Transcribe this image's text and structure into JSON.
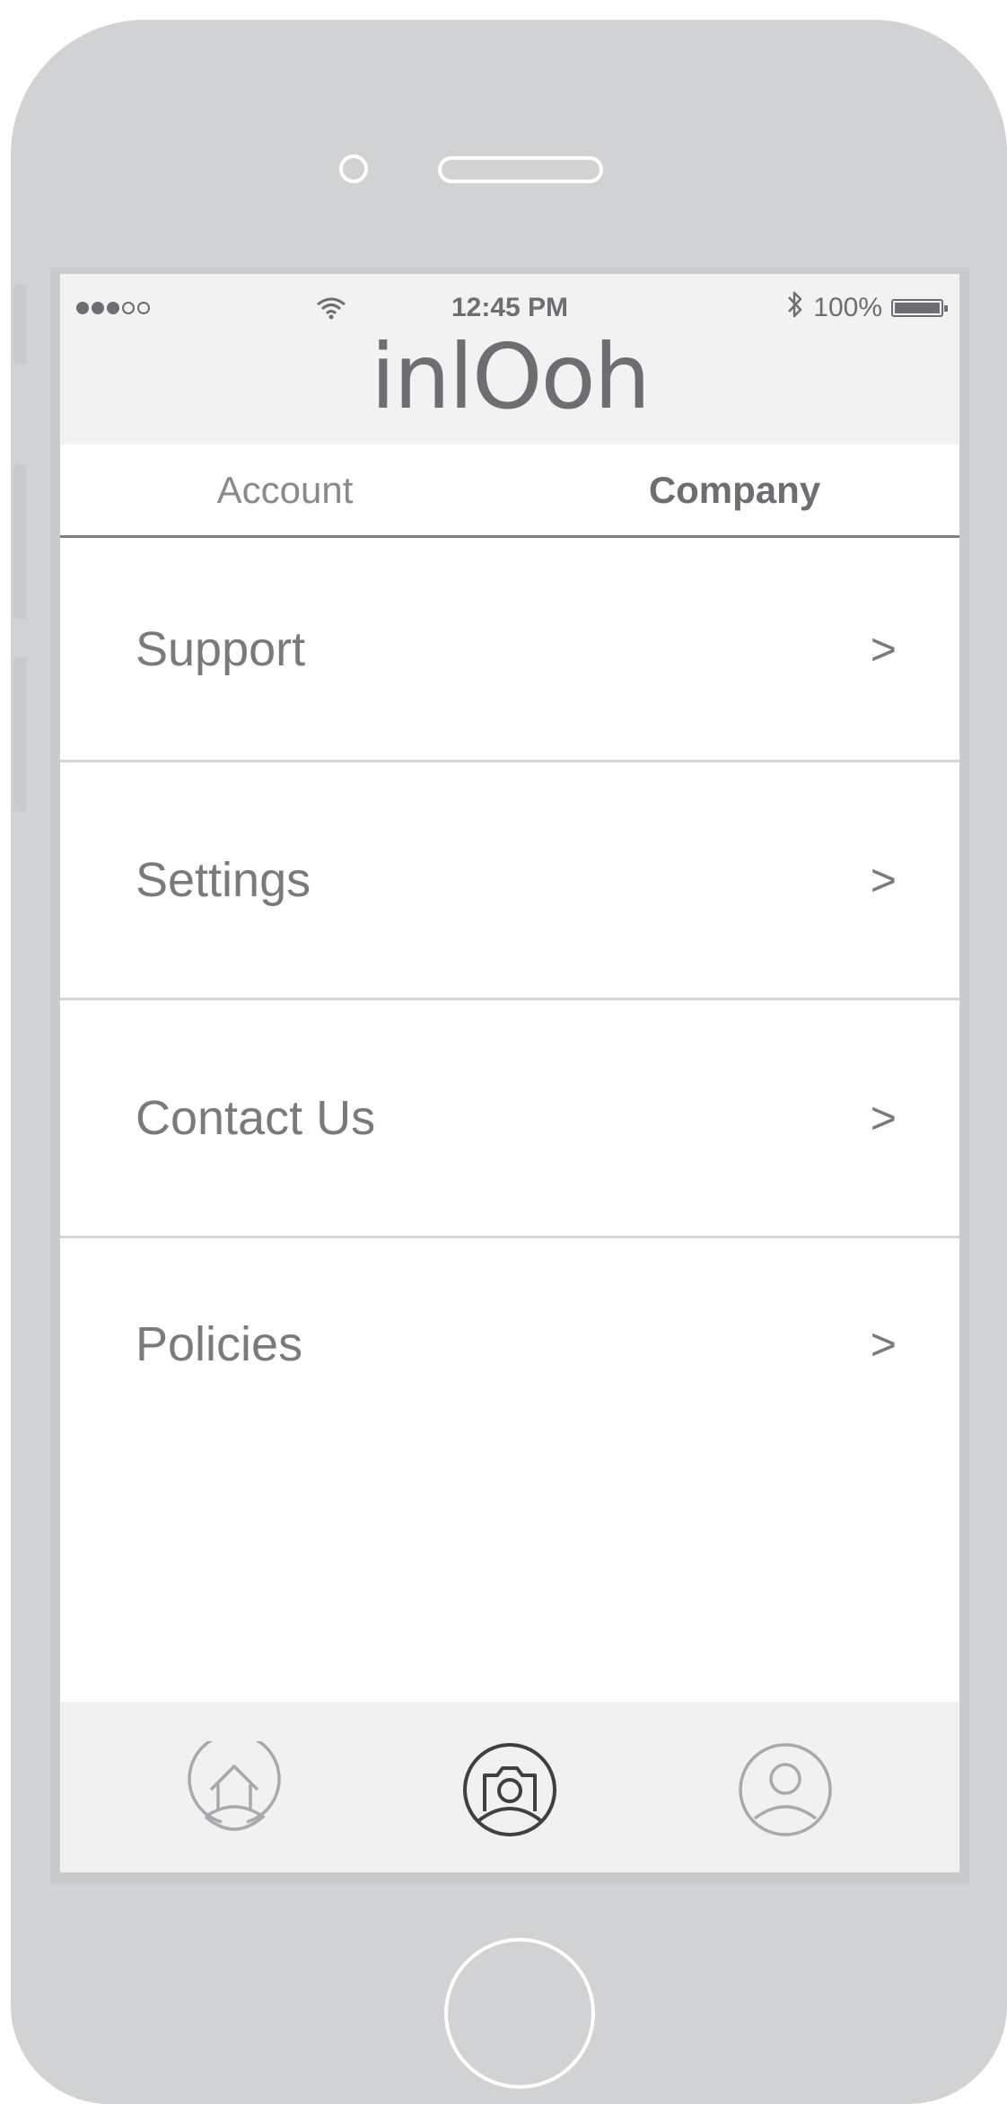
{
  "status_bar": {
    "time": "12:45 PM",
    "battery": "100%",
    "battery_level": 1.0,
    "signal_bars_filled": 3,
    "signal_bars_total": 5,
    "icons": [
      "signal-dots-icon",
      "wifi-icon",
      "bluetooth-icon",
      "battery-icon"
    ]
  },
  "app": {
    "logo": "inlOoh"
  },
  "tabs": [
    {
      "label": "Account",
      "active": false
    },
    {
      "label": "Company",
      "active": true
    }
  ],
  "menu": [
    {
      "label": "Support",
      "chevron": ">"
    },
    {
      "label": "Settings",
      "chevron": ">"
    },
    {
      "label": "Contact Us",
      "chevron": ">"
    },
    {
      "label": "Policies",
      "chevron": ">"
    }
  ],
  "tabbar": {
    "items": [
      {
        "icon": "home-icon",
        "active": false
      },
      {
        "icon": "camera-icon",
        "active": true
      },
      {
        "icon": "profile-icon",
        "active": false
      }
    ]
  },
  "colors": {
    "device": "#d1d2d4",
    "bar_background": "#f2f2f2",
    "text": "#6d6e71",
    "active_icon": "#404040",
    "inactive_icon": "#a7a9ac"
  }
}
